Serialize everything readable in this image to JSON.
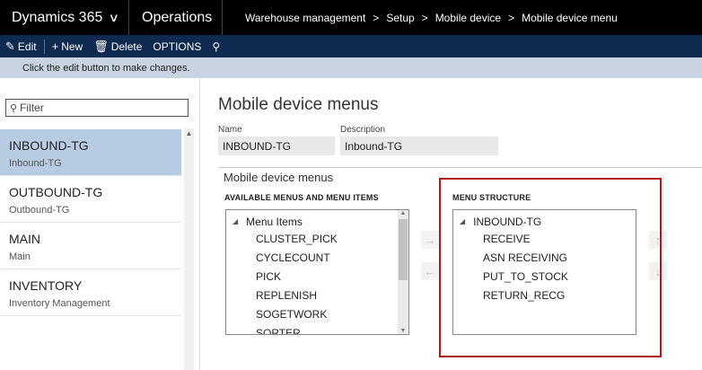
{
  "topbar": {
    "brand": "Dynamics 365",
    "module": "Operations",
    "breadcrumb": [
      "Warehouse management",
      "Setup",
      "Mobile device",
      "Mobile device menu"
    ]
  },
  "actions": {
    "edit": "Edit",
    "new": "New",
    "delete": "Delete",
    "options": "OPTIONS"
  },
  "info": "Click the edit button to make changes.",
  "filter": {
    "placeholder": "Filter"
  },
  "list": [
    {
      "title": "INBOUND-TG",
      "subtitle": "Inbound-TG",
      "selected": true
    },
    {
      "title": "OUTBOUND-TG",
      "subtitle": "Outbound-TG",
      "selected": false
    },
    {
      "title": "MAIN",
      "subtitle": "Main",
      "selected": false
    },
    {
      "title": "INVENTORY",
      "subtitle": "Inventory Management",
      "selected": false
    }
  ],
  "detail": {
    "title": "Mobile device menus",
    "name_label": "Name",
    "name_value": "INBOUND-TG",
    "desc_label": "Description",
    "desc_value": "Inbound-TG",
    "section": "Mobile device menus",
    "available_header": "AVAILABLE MENUS AND MENU ITEMS",
    "structure_header": "MENU STRUCTURE",
    "available_root": "Menu Items",
    "available_items": [
      "CLUSTER_PICK",
      "CYCLECOUNT",
      "PICK",
      "REPLENISH",
      "SOGETWORK",
      "SORTER"
    ],
    "structure_root": "INBOUND-TG",
    "structure_items": [
      "RECEIVE",
      "ASN RECEIVING",
      "PUT_TO_STOCK",
      "RETURN_RECG"
    ]
  },
  "colors": {
    "topbar": "#000000",
    "actionbar": "#0f2a50",
    "infobar": "#c8d3e2",
    "selected": "#b7cbe3",
    "highlight": "#b01a1a"
  }
}
